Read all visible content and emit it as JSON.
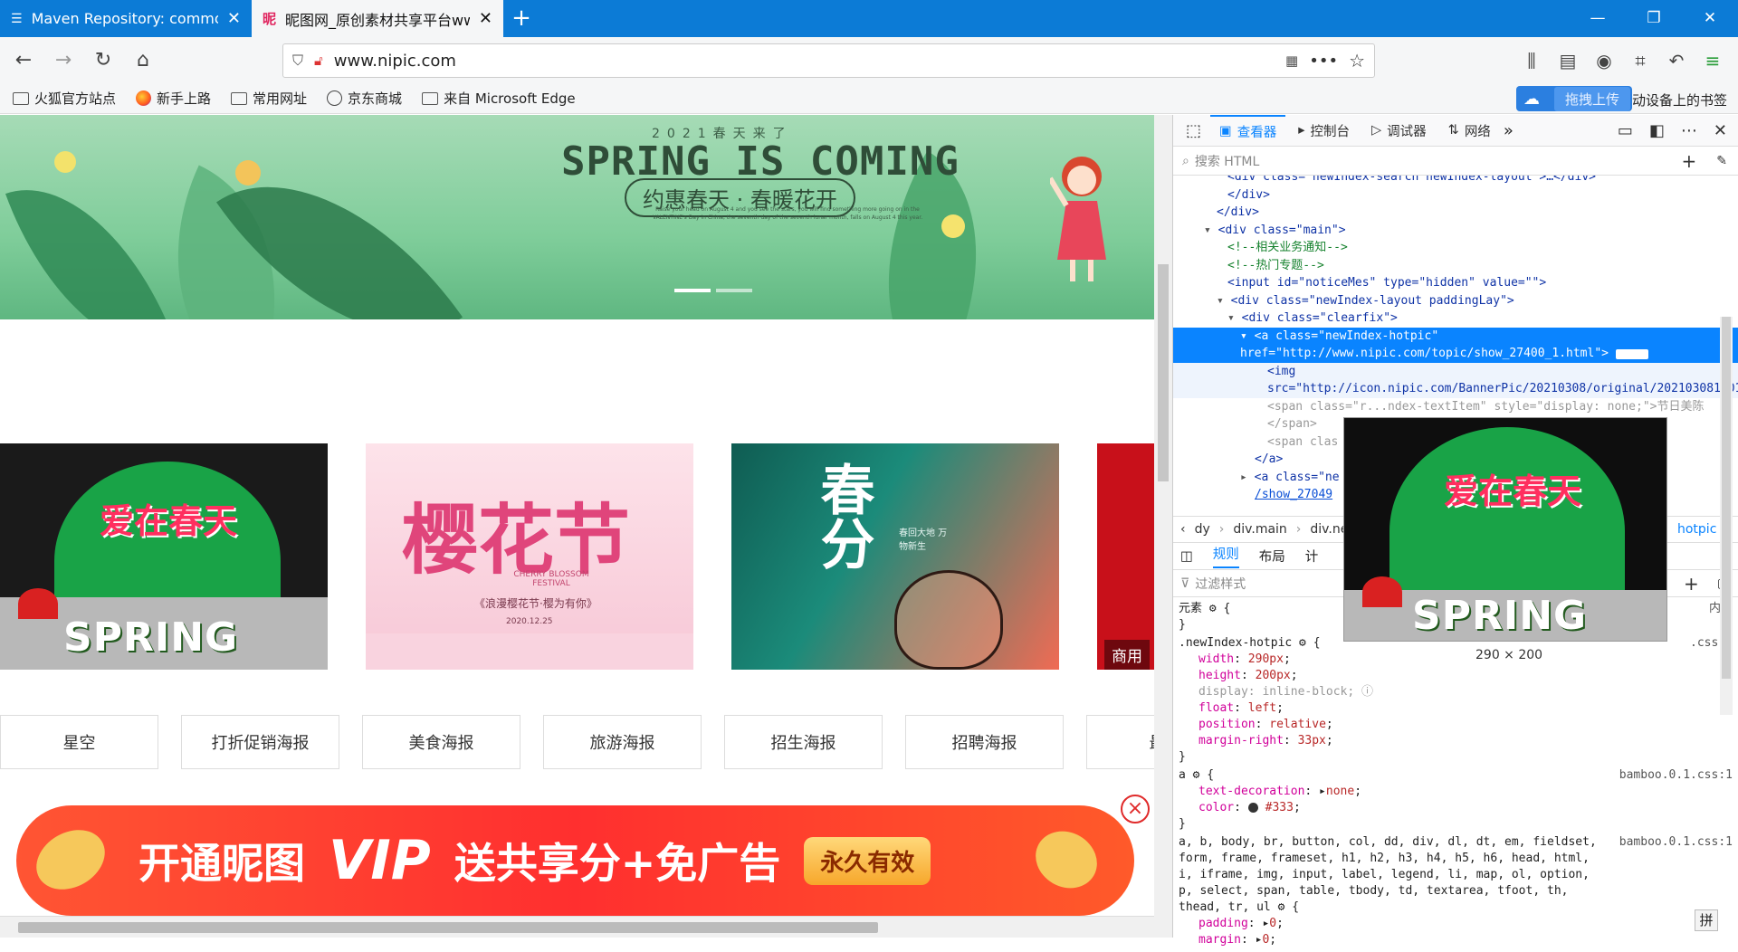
{
  "browser": {
    "tabs": [
      {
        "title": "Maven Repository: commons",
        "active": false
      },
      {
        "title": "昵图网_原创素材共享平台www",
        "active": true
      }
    ],
    "url": "www.nipic.com",
    "bookmarks": [
      "火狐官方站点",
      "新手上路",
      "常用网址",
      "京东商城",
      "来自 Microsoft Edge"
    ],
    "upload_label": "拖拽上传",
    "mobile_bookmarks": "动设备上的书签"
  },
  "page": {
    "banner": {
      "subtitle": "2021春天来了",
      "title": "SPRING IS COMING",
      "slogan": "约惠春天 · 春暖花开",
      "fine_print": "Raise your head on August 4 and you see the stars, you will find something more going on in the VALENTINE's Day in China, the seventh day of the seventh lunar month, falls on August 4 this year."
    },
    "cards": [
      {
        "label_cn": "爱在春天",
        "label_en": "SPRING",
        "tag": ""
      },
      {
        "label_cn": "樱花节",
        "label_en": "CHERRY BLOSSOM FESTIVAL",
        "sub": "《浪漫樱花节·樱为有你》",
        "date": "2020.12.25"
      },
      {
        "label_cn": "春分",
        "sub": "春回大地 万物新生"
      },
      {
        "label_cn": "",
        "tag": "商用"
      }
    ],
    "tags": [
      "星空",
      "打折促销海报",
      "美食海报",
      "旅游海报",
      "招生海报",
      "招聘海报",
      "最新"
    ],
    "vip": {
      "text1": "开通昵图",
      "text2": "VIP",
      "text3": "送共享分+免广告",
      "badge": "永久有效",
      "close": "×"
    }
  },
  "devtools": {
    "tabs": [
      "查看器",
      "控制台",
      "调试器",
      "网络"
    ],
    "search_placeholder": "搜索 HTML",
    "markup": [
      "<div class=\"newIndex-search newIndex-layout\">…</div>",
      "</div>",
      "</div>",
      "<div class=\"main\">",
      "<!--相关业务通知-->",
      "<!--热门专题-->",
      "<input id=\"noticeMes\" type=\"hidden\" value=\"\">",
      "<div class=\"newIndex-layout paddingLay\">",
      "<div class=\"clearfix\">",
      "<a class=\"newIndex-hotpic\" href=\"http://www.nipic.com/topic/show_27400_1.html\">",
      "<img src=\"http://icon.nipic.com/BannerPic/20210308/original/20210308100108_1.jpg\">",
      "<span class=\"r...ndex-textItem\" style=\"display: none;\">节日美陈",
      "</span>",
      "<span clas",
      "</a>",
      "<a class=\"ne",
      "/show_27049"
    ],
    "event_badge": "event",
    "breadcrumbs": [
      "dy",
      "div.main",
      "div.ne",
      "hotpic"
    ],
    "rule_tabs": [
      "规则",
      "布局",
      "计"
    ],
    "filter_placeholder": "过滤样式",
    "element_rule": "元素",
    "inline_label": "内联",
    "rules": {
      "selector1": ".newIndex-hotpic",
      "src1": ".css:1",
      "props1": [
        {
          "name": "width",
          "value": "290px"
        },
        {
          "name": "height",
          "value": "200px"
        },
        {
          "name": "display",
          "value": "inline-block"
        },
        {
          "name": "float",
          "value": "left"
        },
        {
          "name": "position",
          "value": "relative"
        },
        {
          "name": "margin-right",
          "value": "33px"
        }
      ],
      "selector2": "a",
      "src2": "bamboo.0.1.css:1",
      "props2": [
        {
          "name": "text-decoration",
          "value": "none"
        },
        {
          "name": "color",
          "value": "#333"
        }
      ],
      "selector3": "a, b, body, br, button, col, dd, div, dl, dt, em, fieldset, form, frame, frameset, h1, h2, h3, h4, h5, h6, head, html, i, iframe, img, input, label, legend, li, map, ol, option, p, select, span, table, tbody, td, textarea, tfoot, th, thead, tr, ul",
      "src3": "bamboo.0.1.css:1",
      "props3": [
        {
          "name": "padding",
          "value": "0"
        },
        {
          "name": "margin",
          "value": "0"
        }
      ]
    },
    "preview_size": "290 × 200",
    "preview_label_cn": "爱在春天",
    "preview_label_en": "SPRING"
  }
}
